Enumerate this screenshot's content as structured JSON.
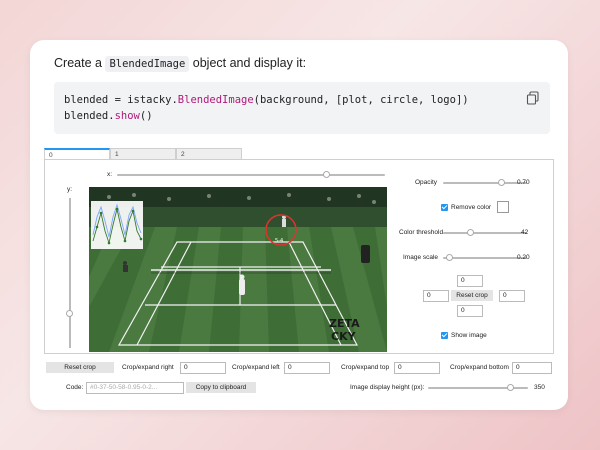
{
  "heading": {
    "before": "Create a",
    "code": "BlendedImage",
    "after": "object and display it:"
  },
  "code_block": {
    "line1": {
      "a": "blended = istacky.",
      "fn": "BlendedImage",
      "b": "(background, [plot, circle, logo])"
    },
    "line2": {
      "a": "blended.",
      "fn": "show",
      "b": "()"
    },
    "copy_icon": "copy-icon"
  },
  "tabs": [
    "0",
    "1",
    "2"
  ],
  "sliders": {
    "x_label": "x:",
    "y_label": "y:",
    "opacity_label": "Opacity",
    "opacity_value": "0.70",
    "opacity_fraction": 0.7,
    "color_threshold_label": "Color threshold",
    "color_threshold_value": "42",
    "color_threshold_fraction": 0.33,
    "image_scale_label": "Image scale",
    "image_scale_value": "0.20",
    "image_scale_fraction": 0.08
  },
  "controls": {
    "remove_color_label": "Remove color",
    "remove_color_checked": true,
    "show_image_label": "Show image",
    "show_image_checked": true,
    "crop_top": "0",
    "crop_left": "0",
    "crop_right": "0",
    "crop_bottom": "0",
    "reset_crop": "Reset crop"
  },
  "bottom": {
    "reset_crop": "Reset crop",
    "crop_right_label": "Crop/expand right",
    "crop_right_value": "0",
    "crop_left_label": "Crop/expand left",
    "crop_left_value": "0",
    "crop_top_label": "Crop/expand top",
    "crop_top_value": "0",
    "crop_bottom_label": "Crop/expand bottom",
    "crop_bottom_value": "0",
    "code_label": "Code:",
    "code_placeholder": "#0-37-50-58-0.95-0-2...",
    "copy_clipboard": "Copy to clipboard",
    "display_height_label": "Image display height (px):",
    "display_height_value": "350",
    "display_height_fraction": 0.82
  },
  "scene": {
    "logo_text_top": "ZETA",
    "logo_text_bottom": "CKY",
    "score_text": "5-4"
  },
  "colors": {
    "accent": "#2196f3",
    "grass": "#3d6b3a",
    "circle": "#e0332f"
  }
}
